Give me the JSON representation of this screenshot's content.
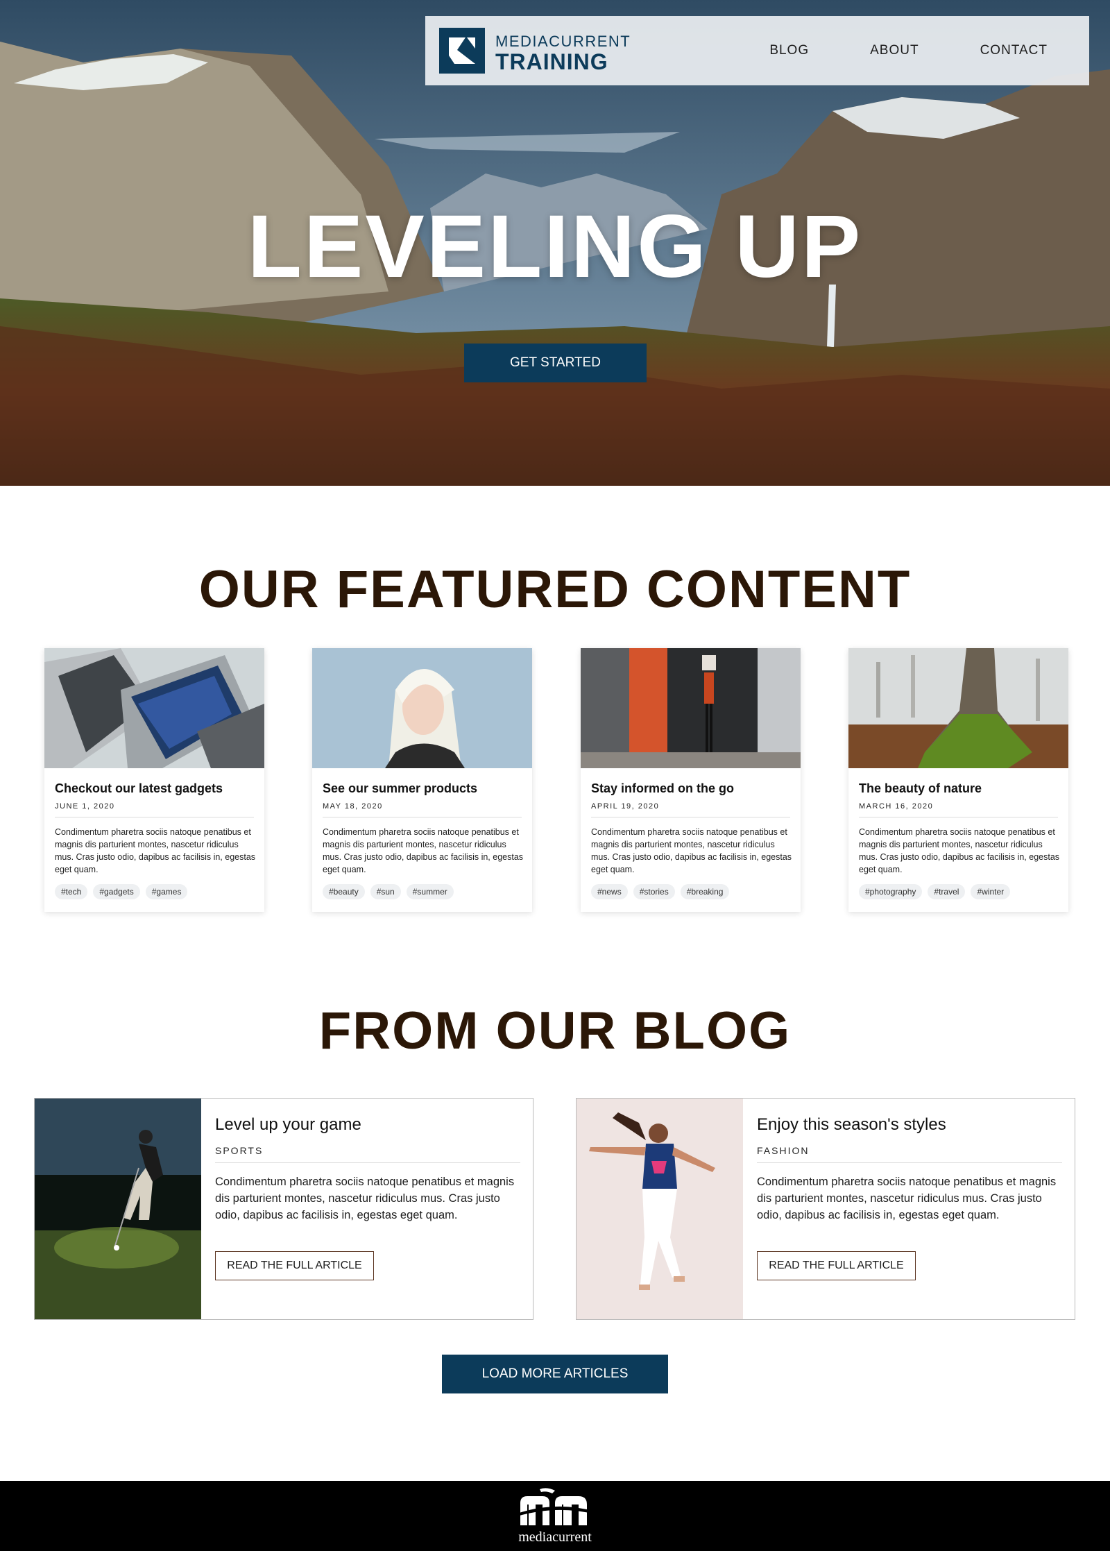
{
  "brand": {
    "line1": "MEDIACURRENT",
    "line2": "TRAINING",
    "accent_color": "#0c3b5a"
  },
  "nav": {
    "items": [
      {
        "label": "BLOG"
      },
      {
        "label": "ABOUT"
      },
      {
        "label": "CONTACT"
      }
    ]
  },
  "hero": {
    "title": "LEVELING UP",
    "cta_label": "GET STARTED"
  },
  "featured": {
    "heading": "OUR FEATURED CONTENT",
    "cards": [
      {
        "title": "Checkout our latest gadgets",
        "date": "JUNE 1, 2020",
        "body": "Condimentum pharetra sociis natoque penatibus et magnis dis parturient montes, nascetur ridiculus mus. Cras justo odio, dapibus ac facilisis in, egestas eget quam.",
        "tags": [
          "#tech",
          "#gadgets",
          "#games"
        ],
        "image": "laptop-image"
      },
      {
        "title": "See our summer products",
        "date": "MAY 18, 2020",
        "body": "Condimentum pharetra sociis natoque penatibus et magnis dis parturient montes, nascetur ridiculus mus. Cras justo odio, dapibus ac facilisis in, egestas eget quam.",
        "tags": [
          "#beauty",
          "#sun",
          "#summer"
        ],
        "image": "portrait-image"
      },
      {
        "title": "Stay informed on the go",
        "date": "APRIL 19, 2020",
        "body": "Condimentum pharetra sociis natoque penatibus et magnis dis parturient montes, nascetur ridiculus mus. Cras justo odio, dapibus ac facilisis in, egestas eget quam.",
        "tags": [
          "#news",
          "#stories",
          "#breaking"
        ],
        "image": "street-image"
      },
      {
        "title": "The beauty of nature",
        "date": "MARCH 16, 2020",
        "body": "Condimentum pharetra sociis natoque penatibus et magnis dis parturient montes, nascetur ridiculus mus. Cras justo odio, dapibus ac facilisis in, egestas eget quam.",
        "tags": [
          "#photography",
          "#travel",
          "#winter"
        ],
        "image": "tree-image"
      }
    ]
  },
  "blog": {
    "heading": "FROM OUR BLOG",
    "posts": [
      {
        "title": "Level up your game",
        "category": "SPORTS",
        "body": "Condimentum pharetra sociis natoque penatibus et magnis dis parturient montes, nascetur ridiculus mus. Cras justo odio, dapibus ac facilisis in, egestas eget quam.",
        "cta_label": "READ THE FULL ARTICLE",
        "image": "golfer-image"
      },
      {
        "title": "Enjoy this season's styles",
        "category": "FASHION",
        "body": "Condimentum pharetra sociis natoque penatibus et magnis dis parturient montes, nascetur ridiculus mus. Cras justo odio, dapibus ac facilisis in, egestas eget quam.",
        "cta_label": "READ THE FULL ARTICLE",
        "image": "dancer-image"
      }
    ],
    "load_more_label": "LOAD MORE ARTICLES"
  },
  "footer": {
    "brand_text": "mediacurrent"
  }
}
